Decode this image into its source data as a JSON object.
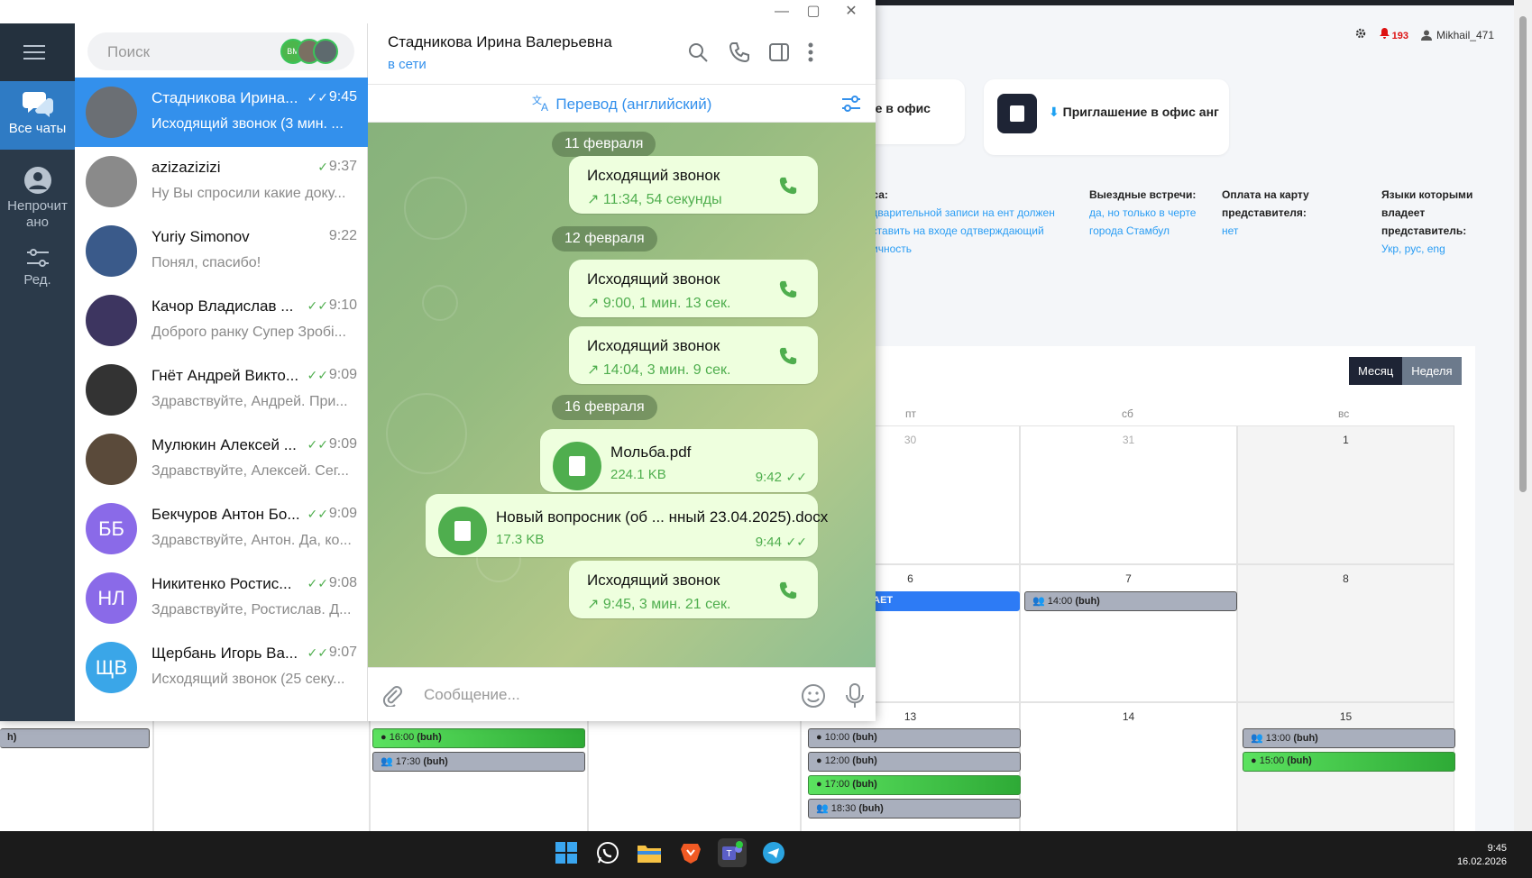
{
  "web": {
    "user": {
      "notif_count": "193",
      "username": "Mikhail_471"
    },
    "card1": {
      "title": "ие в офис"
    },
    "card2": {
      "download_icon": "⬇",
      "title": "Приглашение в офис анг"
    },
    "info": [
      {
        "header": "иса:",
        "value": "едварительной записи на ент должен оставить на входе одтверждающий личность"
      },
      {
        "header": "Выездные встречи:",
        "value": "да, но только в черте города Стамбул"
      },
      {
        "header": "Оплата на карту представителя:",
        "value": "нет"
      },
      {
        "header": "Языки которыми владеет представитель:",
        "value": "Укр, рус, eng"
      }
    ],
    "calendar": {
      "view_month": "Месяц",
      "view_week": "Неделя",
      "weekdays": [
        "пт",
        "сб",
        "вс"
      ],
      "rows": [
        [
          "30",
          "31",
          "1"
        ],
        [
          "6",
          "7",
          "8"
        ],
        [
          "13",
          "14",
          "15"
        ]
      ],
      "events": {
        "row2_fri": "С НЕ РАБОТАЕТ",
        "row2_sat": {
          "time": "14:00",
          "tag": "(buh)"
        },
        "row3_fri": [
          {
            "time": "10:00",
            "tag": "(buh)"
          },
          {
            "time": "12:00",
            "tag": "(buh)"
          },
          {
            "time": "17:00",
            "tag": "(buh)"
          },
          {
            "time": "18:30",
            "tag": "(buh)"
          }
        ],
        "row3_sun": [
          {
            "time": "13:00",
            "tag": "(buh)"
          },
          {
            "time": "15:00",
            "tag": "(buh)"
          }
        ],
        "left_partial": {
          "tag": "h)"
        },
        "left_col": [
          {
            "time": "16:00",
            "tag": "(buh)"
          },
          {
            "time": "17:30",
            "tag": "(buh)"
          }
        ]
      }
    }
  },
  "telegram": {
    "window_buttons": {
      "minimize": "—",
      "maximize": "▢",
      "close": "✕"
    },
    "rail": [
      {
        "label": "Все чаты",
        "icon": "chats-icon"
      },
      {
        "label": "Непрочитано",
        "icon": "person-icon"
      },
      {
        "label": "Ред.",
        "icon": "edit-folders-icon"
      }
    ],
    "search": {
      "placeholder": "Поиск",
      "story_avatar": "ВМ"
    },
    "chats": [
      {
        "name": "Стадникова Ирина...",
        "time": "9:45",
        "preview": "Исходящий звонок (3 мин. ...",
        "avatar_color": "#6b6f74"
      },
      {
        "name": "azizazizizi",
        "time": "9:37",
        "preview": "Ну Вы спросили какие доку...",
        "avatar_color": "#8a8a8a"
      },
      {
        "name": "Yuriy Simonov",
        "time": "9:22",
        "preview": "Понял, спасибо!",
        "avatar_color": "#3a5a8a"
      },
      {
        "name": "Качор Владислав ...",
        "time": "9:10",
        "preview": "Доброго ранку Супер Зробі...",
        "avatar_color": "#3d3560"
      },
      {
        "name": "Гнёт Андрей Викто...",
        "time": "9:09",
        "preview": "Здравствуйте, Андрей. При...",
        "avatar_color": "#333333"
      },
      {
        "name": "Мулюкин Алексей ...",
        "time": "9:09",
        "preview": "Здравствуйте, Алексей. Сег...",
        "avatar_color": "#5a4a3a"
      },
      {
        "name": "Бекчуров Антон Бо...",
        "time": "9:09",
        "preview": "Здравствуйте, Антон. Да, ко...",
        "avatar_color": "#8a6ae8",
        "initials": "ББ"
      },
      {
        "name": "Никитенко Ростис...",
        "time": "9:08",
        "preview": "Здравствуйте, Ростислав. Д...",
        "avatar_color": "#8a6ae8",
        "initials": "НЛ"
      },
      {
        "name": "Щербань Игорь Ва...",
        "time": "9:07",
        "preview": "Исходящий звонок (25 секу...",
        "avatar_color": "#3aa6e8",
        "initials": "ЩВ"
      }
    ],
    "chat": {
      "name": "Стадникова Ирина Валерьевна",
      "status": "в сети",
      "translate_bar": "Перевод (английский)",
      "messages": [
        {
          "kind": "date",
          "text": "11 февраля"
        },
        {
          "kind": "call",
          "title": "Исходящий звонок",
          "detail": "11:34, 54 секунды"
        },
        {
          "kind": "date",
          "text": "12 февраля"
        },
        {
          "kind": "call",
          "title": "Исходящий звонок",
          "detail": "9:00, 1 мин. 13 сек."
        },
        {
          "kind": "call",
          "title": "Исходящий звонок",
          "detail": "14:04, 3 мин. 9 сек."
        },
        {
          "kind": "date",
          "text": "16 февраля"
        },
        {
          "kind": "file",
          "name": "Мольба.pdf",
          "size": "224.1 KB",
          "time": "9:42"
        },
        {
          "kind": "file",
          "name": "Новый вопросник (об ... нный 23.04.2025).docx",
          "size": "17.3 KB",
          "time": "9:44"
        },
        {
          "kind": "call",
          "title": "Исходящий звонок",
          "detail": "9:45, 3 мин. 21 сек."
        }
      ],
      "composer_placeholder": "Сообщение..."
    }
  },
  "taskbar": {
    "apps": [
      "windows-start-icon",
      "whatsapp-icon",
      "file-explorer-icon",
      "brave-browser-icon",
      "teams-icon",
      "telegram-icon"
    ],
    "time": "9:45",
    "date": "16.02.2026"
  }
}
